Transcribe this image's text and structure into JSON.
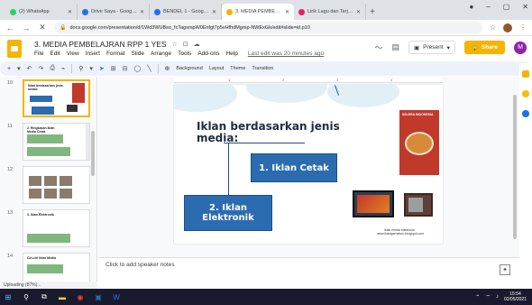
{
  "browser": {
    "tabs": [
      {
        "label": "(2) WhatsApp",
        "color": "#25d366"
      },
      {
        "label": "Drive Saya - Google Drive",
        "color": "#1a73e8"
      },
      {
        "label": "BENDEL 1 - Google Drive",
        "color": "#1a73e8"
      },
      {
        "label": "3. MEDIA PEMBELAJRAN",
        "color": "#f4b400",
        "active": true
      },
      {
        "label": "Lirik Lagu dan Terjemahan",
        "color": "#e91e63"
      }
    ],
    "window_controls": [
      "–",
      "▢",
      "✕"
    ],
    "url": "docs.google.com/presentation/d/1Wd3WUBso_fcTagsmpW0Enfgt7p5vHfhdMgmp-NWExGk/edit#slide=id.p10"
  },
  "docs": {
    "title": "3. MEDIA PEMBELAJRAN RPP 1 YES",
    "menus": [
      "File",
      "Edit",
      "View",
      "Insert",
      "Format",
      "Slide",
      "Arrange",
      "Tools",
      "Add-ons",
      "Help"
    ],
    "last_edit": "Last edit was 20 minutes ago",
    "present_label": "Present",
    "share_label": "Share",
    "user_initial": "M"
  },
  "toolbar": {
    "background_label": "Background",
    "layout_label": "Layout",
    "theme_label": "Theme",
    "transition_label": "Transition"
  },
  "filmstrip": {
    "slides": [
      {
        "number": "10",
        "title": "Iklan berdasarkan jenis media:",
        "selected": true
      },
      {
        "number": "11",
        "title": "2. Ringkasan Iklan Media Cetak"
      },
      {
        "number": "12",
        "title": ""
      },
      {
        "number": "13",
        "title": "3. Iklan Elektronik"
      },
      {
        "number": "14",
        "title": "Ciri-ciri Iklan Media"
      }
    ]
  },
  "slide": {
    "title": "Iklan berdasarkan jenis media:",
    "box1": "1. Iklan Cetak",
    "box2": "2. Iklan Elektronik",
    "poster_text": "SELERA INDONESIA",
    "caption": "iklan media elektronik",
    "caption2": "www.iklangarneluru.blogspot.com"
  },
  "speaker_notes": "Click to add speaker notes",
  "status": "Uploading (87%)...",
  "taskbar": {
    "time": "15:54",
    "date": "02/05/2021"
  }
}
